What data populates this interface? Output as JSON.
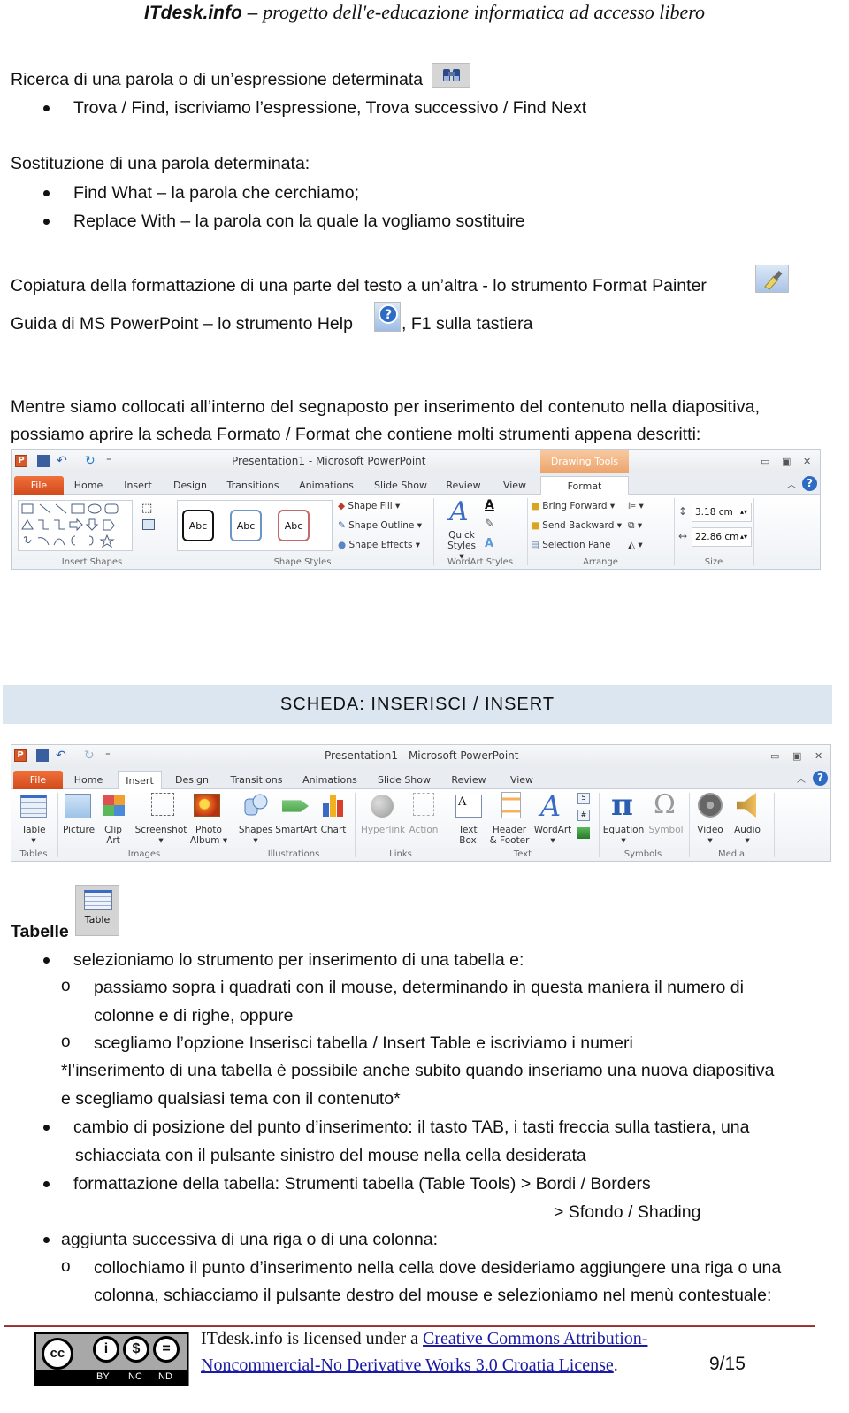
{
  "header": {
    "brand": "ITdesk.info",
    "dash": " – ",
    "tagline": "progetto dell'e-educazione informatica ad accesso libero"
  },
  "find": {
    "heading": "Ricerca di una parola o di un’espressione determinata",
    "icon": "binoculars-icon",
    "bullets": [
      "Trova / Find, iscriviamo l’espressione, Trova successivo / Find Next"
    ]
  },
  "replace": {
    "heading": "Sostituzione di una parola determinata:",
    "bullets": [
      "Find What – la parola che cerchiamo;",
      "Replace With – la parola con la quale la vogliamo sostituire"
    ]
  },
  "format_painter": {
    "text": "Copiatura della formattazione di una parte del testo a un’altra - lo strumento Format Painter",
    "icon": "paintbrush-icon"
  },
  "help": {
    "text_before": "Guida di MS PowerPoint – lo strumento Help",
    "text_after": ", F1 sulla tastiera",
    "icon": "help-question-icon"
  },
  "format_intro": {
    "line1": "Mentre siamo collocati all’interno del segnaposto per inserimento del contenuto nella diapositiva,",
    "line2": "possiamo aprire la scheda Formato / Format che contiene molti strumenti appena descritti:"
  },
  "ribbon_format": {
    "window_title": "Presentation1  -  Microsoft PowerPoint",
    "context_tab": "Drawing Tools",
    "tabs": [
      "File",
      "Home",
      "Insert",
      "Design",
      "Transitions",
      "Animations",
      "Slide Show",
      "Review",
      "View",
      "Format"
    ],
    "active_tab": "Format",
    "groups": {
      "insert_shapes": "Insert Shapes",
      "shape_styles": "Shape Styles",
      "wordart_styles": "WordArt Styles",
      "arrange": "Arrange",
      "size": "Size"
    },
    "style_samples": [
      "Abc",
      "Abc",
      "Abc"
    ],
    "shape_fill": "Shape Fill",
    "shape_outline": "Shape Outline",
    "shape_effects": "Shape Effects",
    "quick_styles_1": "Quick",
    "quick_styles_2": "Styles",
    "bring_forward": "Bring Forward",
    "send_backward": "Send Backward",
    "selection_pane": "Selection Pane",
    "height_value": "3.18 cm",
    "width_value": "22.86 cm"
  },
  "section": {
    "title": "SCHEDA: INSERISCI / INSERT"
  },
  "ribbon_insert": {
    "window_title": "Presentation1  -  Microsoft PowerPoint",
    "tabs": [
      "File",
      "Home",
      "Insert",
      "Design",
      "Transitions",
      "Animations",
      "Slide Show",
      "Review",
      "View"
    ],
    "active_tab": "Insert",
    "buttons": {
      "table": "Table",
      "picture": "Picture",
      "clip_art_1": "Clip",
      "clip_art_2": "Art",
      "screenshot": "Screenshot",
      "photo_album_1": "Photo",
      "photo_album_2": "Album",
      "shapes": "Shapes",
      "smartart": "SmartArt",
      "chart": "Chart",
      "hyperlink": "Hyperlink",
      "action": "Action",
      "text_box_1": "Text",
      "text_box_2": "Box",
      "header_footer_1": "Header",
      "header_footer_2": "& Footer",
      "wordart": "WordArt",
      "equation": "Equation",
      "symbol": "Symbol",
      "video": "Video",
      "audio": "Audio"
    },
    "groups": {
      "tables": "Tables",
      "images": "Images",
      "illustrations": "Illustrations",
      "links": "Links",
      "text": "Text",
      "symbols": "Symbols",
      "media": "Media"
    }
  },
  "tables": {
    "heading": "Tabelle",
    "icon_label": "Table",
    "items": [
      "selezioniamo lo strumento per inserimento di una tabella e:",
      "passiamo sopra i quadrati con il mouse, determinando in questa maniera il numero di",
      "colonne e di righe, oppure",
      "scegliamo l’opzione Inserisci tabella / Insert Table e iscriviamo i numeri",
      "*l’inserimento di una tabella è possibile anche subito quando inseriamo una nuova diapositiva",
      "e scegliamo qualsiasi tema con il contenuto*",
      "cambio di posizione del punto d’inserimento: il tasto TAB, i tasti freccia sulla tastiera, una",
      "schiacciata con il pulsante sinistro del mouse nella cella desiderata",
      "formattazione della tabella: Strumenti tabella (Table Tools) > Bordi / Borders",
      "> Sfondo / Shading",
      "aggiunta successiva di una riga o di una colonna:",
      "collochiamo il punto d’inserimento nella cella dove desideriamo aggiungere una riga o una",
      "colonna, schiacciamo il pulsante destro del mouse e selezioniamo nel menù contestuale:"
    ]
  },
  "footer": {
    "license_prefix": "ITdesk.info is licensed under a ",
    "license_link_1": "Creative Commons Attribution-",
    "license_link_2": "Noncommercial-No Derivative Works 3.0 Croatia License",
    "license_suffix": ".",
    "page": "9/15",
    "cc_labels": [
      "BY",
      "NC",
      "ND"
    ]
  },
  "colors": {
    "section_bar": "#dce6f1",
    "file_tab": "#d24a1c",
    "context_tab": "#f3b27a",
    "footer_rule": "#a8332f",
    "link": "#1a1aa6"
  }
}
